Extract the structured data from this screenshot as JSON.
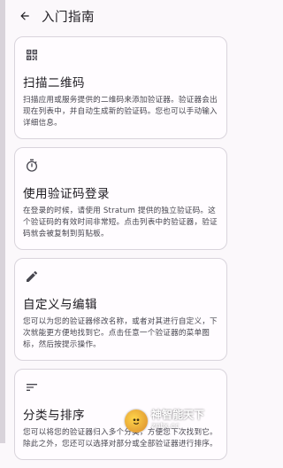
{
  "topbar": {
    "title": "入门指南",
    "back_icon": "arrow-back-icon"
  },
  "cards": [
    {
      "icon": "qr-code-icon",
      "title": "扫描二维码",
      "body": "扫描应用或服务提供的二维码来添加验证器。验证器会出现在列表中，并自动生成新的验证码。您也可以手动输入详细信息。"
    },
    {
      "icon": "stopwatch-icon",
      "title": "使用验证码登录",
      "body": "在登录的时候，请使用 Stratum 提供的独立验证码。这个验证码的有效时间非常短。点击列表中的验证器，验证码就会被复制到剪贴板。"
    },
    {
      "icon": "pencil-icon",
      "title": "自定义与编辑",
      "body": "您可以为您的验证器修改名称，或者对其进行自定义，下次就能更方便地找到它。点击任意一个验证器的菜单图标，然后按提示操作。"
    },
    {
      "icon": "sort-icon",
      "title": "分类与排序",
      "body": "您可以将您的验证器归入多个分类，方便您下次找到它。除此之外，您还可以选择对部分或全部验证器进行排序。"
    }
  ],
  "watermark": {
    "brand": "神智能天下",
    "url": "zntx.cc"
  },
  "colors": {
    "background": "#fbf8fb",
    "card_border": "#d9d4dc",
    "text_primary": "#1d1b20",
    "text_secondary": "#47464f"
  }
}
